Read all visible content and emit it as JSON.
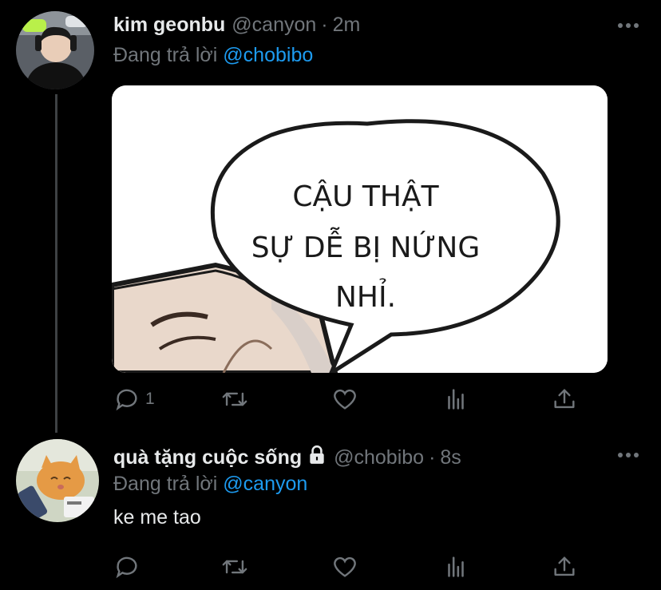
{
  "tweets": [
    {
      "display_name": "kim geonbu",
      "handle": "@canyon",
      "separator": "·",
      "time": "2m",
      "replying_prefix": "Đang trả lời",
      "replying_to": "@chobibo",
      "media": {
        "speech_line1": "CẬU THẬT",
        "speech_line2": "SỰ DỄ BỊ NỨNG",
        "speech_line3": "NHỈ."
      },
      "actions": {
        "reply_count": "1"
      }
    },
    {
      "display_name": "quà tặng cuộc sống",
      "protected_icon": "lock-icon",
      "handle": "@chobibo",
      "separator": "·",
      "time": "8s",
      "replying_prefix": "Đang trả lời",
      "replying_to": "@canyon",
      "text": "ke me tao"
    }
  ],
  "icons": [
    "reply-icon",
    "retweet-icon",
    "like-icon",
    "analytics-icon",
    "share-icon",
    "more-icon"
  ],
  "colors": {
    "background": "#000000",
    "text": "#e7e9ea",
    "secondary": "#71767b",
    "link": "#1d9bf0",
    "thread_line": "#3e4144"
  }
}
